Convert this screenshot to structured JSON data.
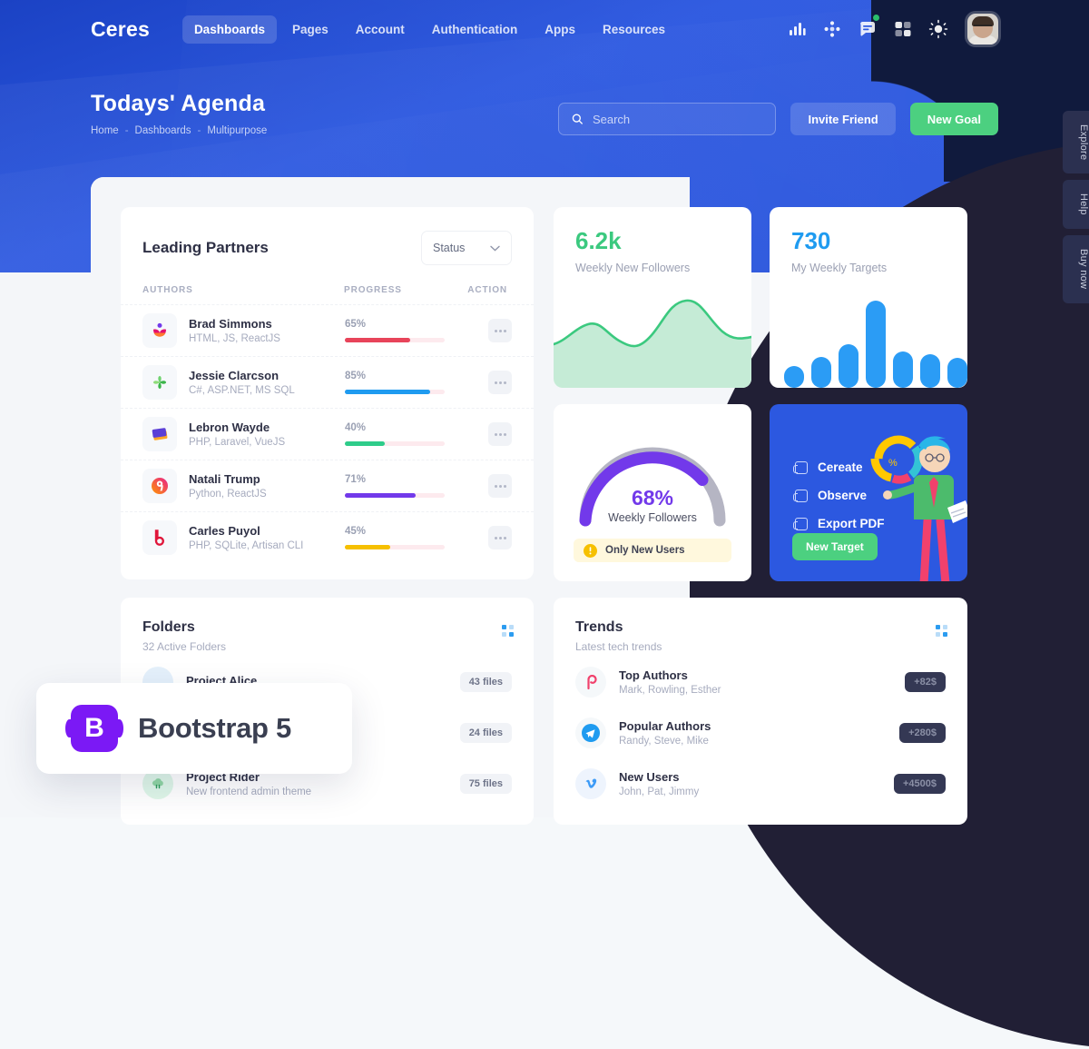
{
  "brand": "Ceres",
  "nav": {
    "items": [
      {
        "label": "Dashboards",
        "active": true
      },
      {
        "label": "Pages",
        "active": false
      },
      {
        "label": "Account",
        "active": false
      },
      {
        "label": "Authentication",
        "active": false
      },
      {
        "label": "Apps",
        "active": false
      },
      {
        "label": "Resources",
        "active": false
      }
    ],
    "icons": [
      "bar-chart-icon",
      "sparkle-icon",
      "chat-icon",
      "grid-icon",
      "sun-icon"
    ]
  },
  "header": {
    "title": "Todays' Agenda",
    "breadcrumb": [
      "Home",
      "-",
      "Dashboards",
      "-",
      "Multipurpose"
    ],
    "search_placeholder": "Search",
    "search_value": "",
    "invite_label": "Invite Friend",
    "new_goal_label": "New Goal"
  },
  "side_tabs": [
    "Explore",
    "Help",
    "Buy now"
  ],
  "partners": {
    "title": "Leading Partners",
    "status_label": "Status",
    "columns": [
      "AUTHORS",
      "PROGRESS",
      "ACTION"
    ],
    "rows": [
      {
        "name": "Brad Simmons",
        "stack": "HTML, JS, ReactJS",
        "progress": "65%",
        "value": 65,
        "color": "#e8445a",
        "track": "#fdeaee"
      },
      {
        "name": "Jessie Clarcson",
        "stack": "C#, ASP.NET, MS SQL",
        "progress": "85%",
        "value": 85,
        "color": "#1f9bf0",
        "track": "#fdeaee"
      },
      {
        "name": "Lebron Wayde",
        "stack": "PHP, Laravel, VueJS",
        "progress": "40%",
        "value": 40,
        "color": "#2ecc8a",
        "track": "#fdeaee"
      },
      {
        "name": "Natali Trump",
        "stack": "Python, ReactJS",
        "progress": "71%",
        "value": 71,
        "color": "#7239ea",
        "track": "#fdeaee"
      },
      {
        "name": "Carles Puyol",
        "stack": "PHP, SQLite, Artisan CLI",
        "progress": "45%",
        "value": 45,
        "color": "#f6c000",
        "track": "#fdeaee"
      }
    ]
  },
  "stat_followers": {
    "value": "6.2k",
    "label": "Weekly New Followers",
    "color": "#3bc97f"
  },
  "stat_targets": {
    "value": "730",
    "label": "My Weekly Targets",
    "color": "#1f9bf0"
  },
  "gauge": {
    "percent": "68%",
    "label": "Weekly Followers",
    "value": 68,
    "color": "#7239ea",
    "track": "#b5b5c3",
    "alert_text": "Only New Users",
    "alert_icon": "warning-icon"
  },
  "target_card": {
    "items": [
      "Cereate",
      "Observe",
      "Export PDF"
    ],
    "button_label": "New Target",
    "bg": "#2c58e0"
  },
  "folders": {
    "title": "Folders",
    "subtitle": "32 Active Folders",
    "rows": [
      {
        "name": "Project Alice",
        "desc": "",
        "files": "43 files",
        "color": "#e4f0fb"
      },
      {
        "name": "",
        "desc": "",
        "files": "24 files",
        "color": "#fdeaee"
      },
      {
        "name": "Project Rider",
        "desc": "New frontend admin theme",
        "files": "75 files",
        "color": "#dff7e9"
      }
    ]
  },
  "trends": {
    "title": "Trends",
    "subtitle": "Latest tech trends",
    "rows": [
      {
        "name": "Top Authors",
        "desc": "Mark, Rowling, Esther",
        "amount": "+82$",
        "icon": "p-logo-icon",
        "color": "#f5f8fa",
        "glyph_color": "#f1416c"
      },
      {
        "name": "Popular Authors",
        "desc": "Randy, Steve, Mike",
        "amount": "+280$",
        "icon": "telegram-icon",
        "color": "#f5f8fa",
        "glyph_color": "#1f9bf0"
      },
      {
        "name": "New Users",
        "desc": "John, Pat, Jimmy",
        "amount": "+4500$",
        "icon": "vimeo-icon",
        "color": "#eef4fd",
        "glyph_color": "#3d9bf7"
      }
    ]
  },
  "overlay": {
    "logo_letter": "B",
    "text": "Bootstrap 5"
  },
  "chart_data": [
    {
      "type": "area",
      "title": "Weekly New Followers",
      "x": [
        0,
        1,
        2,
        3,
        4,
        5,
        6,
        7,
        8
      ],
      "values": [
        30,
        42,
        58,
        50,
        34,
        32,
        72,
        88,
        68,
        52
      ],
      "color": "#3bc97f",
      "fill": "#c5ebd6",
      "ylim": [
        0,
        100
      ]
    },
    {
      "type": "bar",
      "title": "My Weekly Targets",
      "categories": [
        "1",
        "2",
        "3",
        "4",
        "5",
        "6",
        "7"
      ],
      "values": [
        17,
        28,
        40,
        100,
        33,
        30,
        27
      ],
      "color": "#2b9cf5",
      "ylim": [
        0,
        100
      ]
    },
    {
      "type": "gauge",
      "title": "Weekly Followers",
      "values": [
        68
      ],
      "value_label": "68%",
      "color": "#7239ea",
      "track_color": "#b5b5c3",
      "ylim": [
        0,
        100
      ]
    }
  ]
}
